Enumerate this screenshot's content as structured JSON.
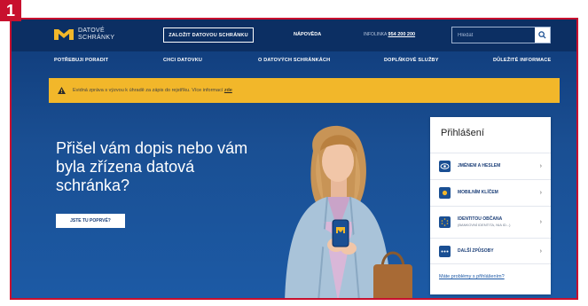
{
  "figure_number": "1",
  "header": {
    "logo_text_line1": "DATOVÉ",
    "logo_text_line2": "SCHRÁNKY",
    "establish_button": "ZALOŽIT DATOVOU SCHRÁNKU",
    "help_link": "NÁPOVĚDA",
    "infoline_label": "INFOLINKA",
    "infoline_number": "954 200 200",
    "search_placeholder": "Hledat"
  },
  "nav": {
    "items": [
      "POTŘEBUJI PORADIT",
      "CHCI DATOVKU",
      "O DATOVÝCH SCHRÁNKÁCH",
      "DOPLŇKOVÉ SLUŽBY",
      "DŮLEŽITÉ INFORMACE"
    ]
  },
  "alert": {
    "text": "Evidná zpráva s výzvou k úhradě za zápis do rejstříku. Více informací",
    "link": "zde"
  },
  "hero": {
    "title": "Přišel vám dopis nebo vám byla zřízena datová schránka?",
    "cta": "JSTE TU POPRVÉ?"
  },
  "login": {
    "title": "Přihlášení",
    "items": [
      {
        "label": "JMÉNEM A HESLEM",
        "sub": "",
        "icon": "eye-icon"
      },
      {
        "label": "MOBILNÍM KLÍČEM",
        "sub": "",
        "icon": "key-icon"
      },
      {
        "label": "IDENTITOU OBČANA",
        "sub": "(BANKOVNÍ IDENTITA, NIA ID...)",
        "icon": "eu-flag-icon"
      },
      {
        "label": "DALŠÍ ZPŮSOBY",
        "sub": "",
        "icon": "more-icon"
      }
    ],
    "problem_link": "Máte problémy s přihlášením?"
  },
  "colors": {
    "brand_blue": "#1a4f93",
    "header_blue": "#0c2f63",
    "alert_yellow": "#f2b72a",
    "frame_red": "#c8102e"
  }
}
